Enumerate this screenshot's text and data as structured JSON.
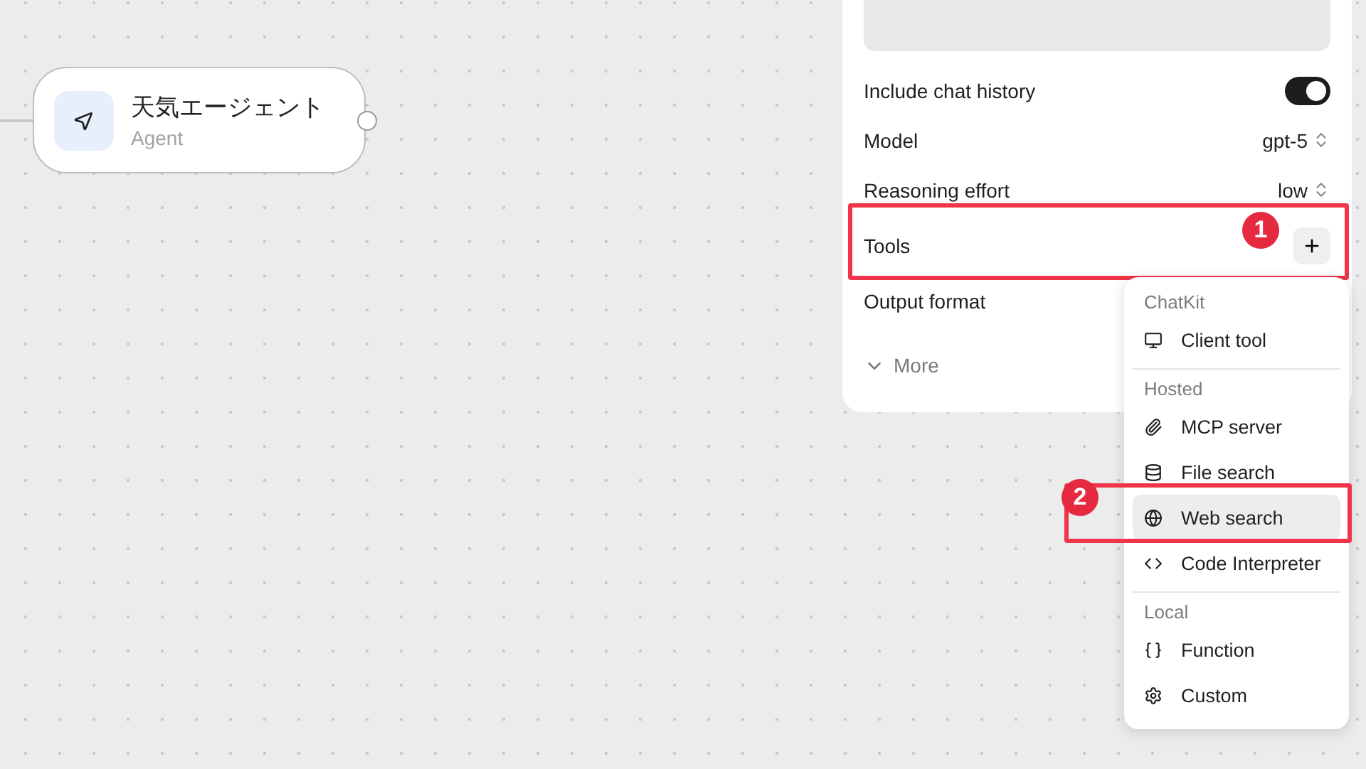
{
  "node": {
    "title": "天気エージェント",
    "subtitle": "Agent"
  },
  "panel": {
    "rows": [
      {
        "kind": "toggle",
        "label": "Include chat history",
        "on": true
      },
      {
        "kind": "select",
        "label": "Model",
        "value": "gpt-5"
      },
      {
        "kind": "select",
        "label": "Reasoning effort",
        "value": "low"
      },
      {
        "kind": "add",
        "label": "Tools",
        "highlighted": true,
        "badge": "1"
      },
      {
        "kind": "plain",
        "label": "Output format"
      }
    ],
    "more": "More"
  },
  "menu": {
    "sections": [
      {
        "header": "ChatKit",
        "items": [
          {
            "label": "Client tool",
            "selected": false
          }
        ]
      },
      {
        "header": "Hosted",
        "items": [
          {
            "label": "MCP server",
            "selected": false
          },
          {
            "label": "File search",
            "selected": false
          },
          {
            "label": "Web search",
            "selected": true,
            "highlighted": true,
            "badge": "2"
          },
          {
            "label": "Code Interpreter",
            "selected": false
          }
        ]
      },
      {
        "header": "Local",
        "items": [
          {
            "label": "Function",
            "selected": false
          },
          {
            "label": "Custom",
            "selected": false
          }
        ]
      }
    ]
  }
}
